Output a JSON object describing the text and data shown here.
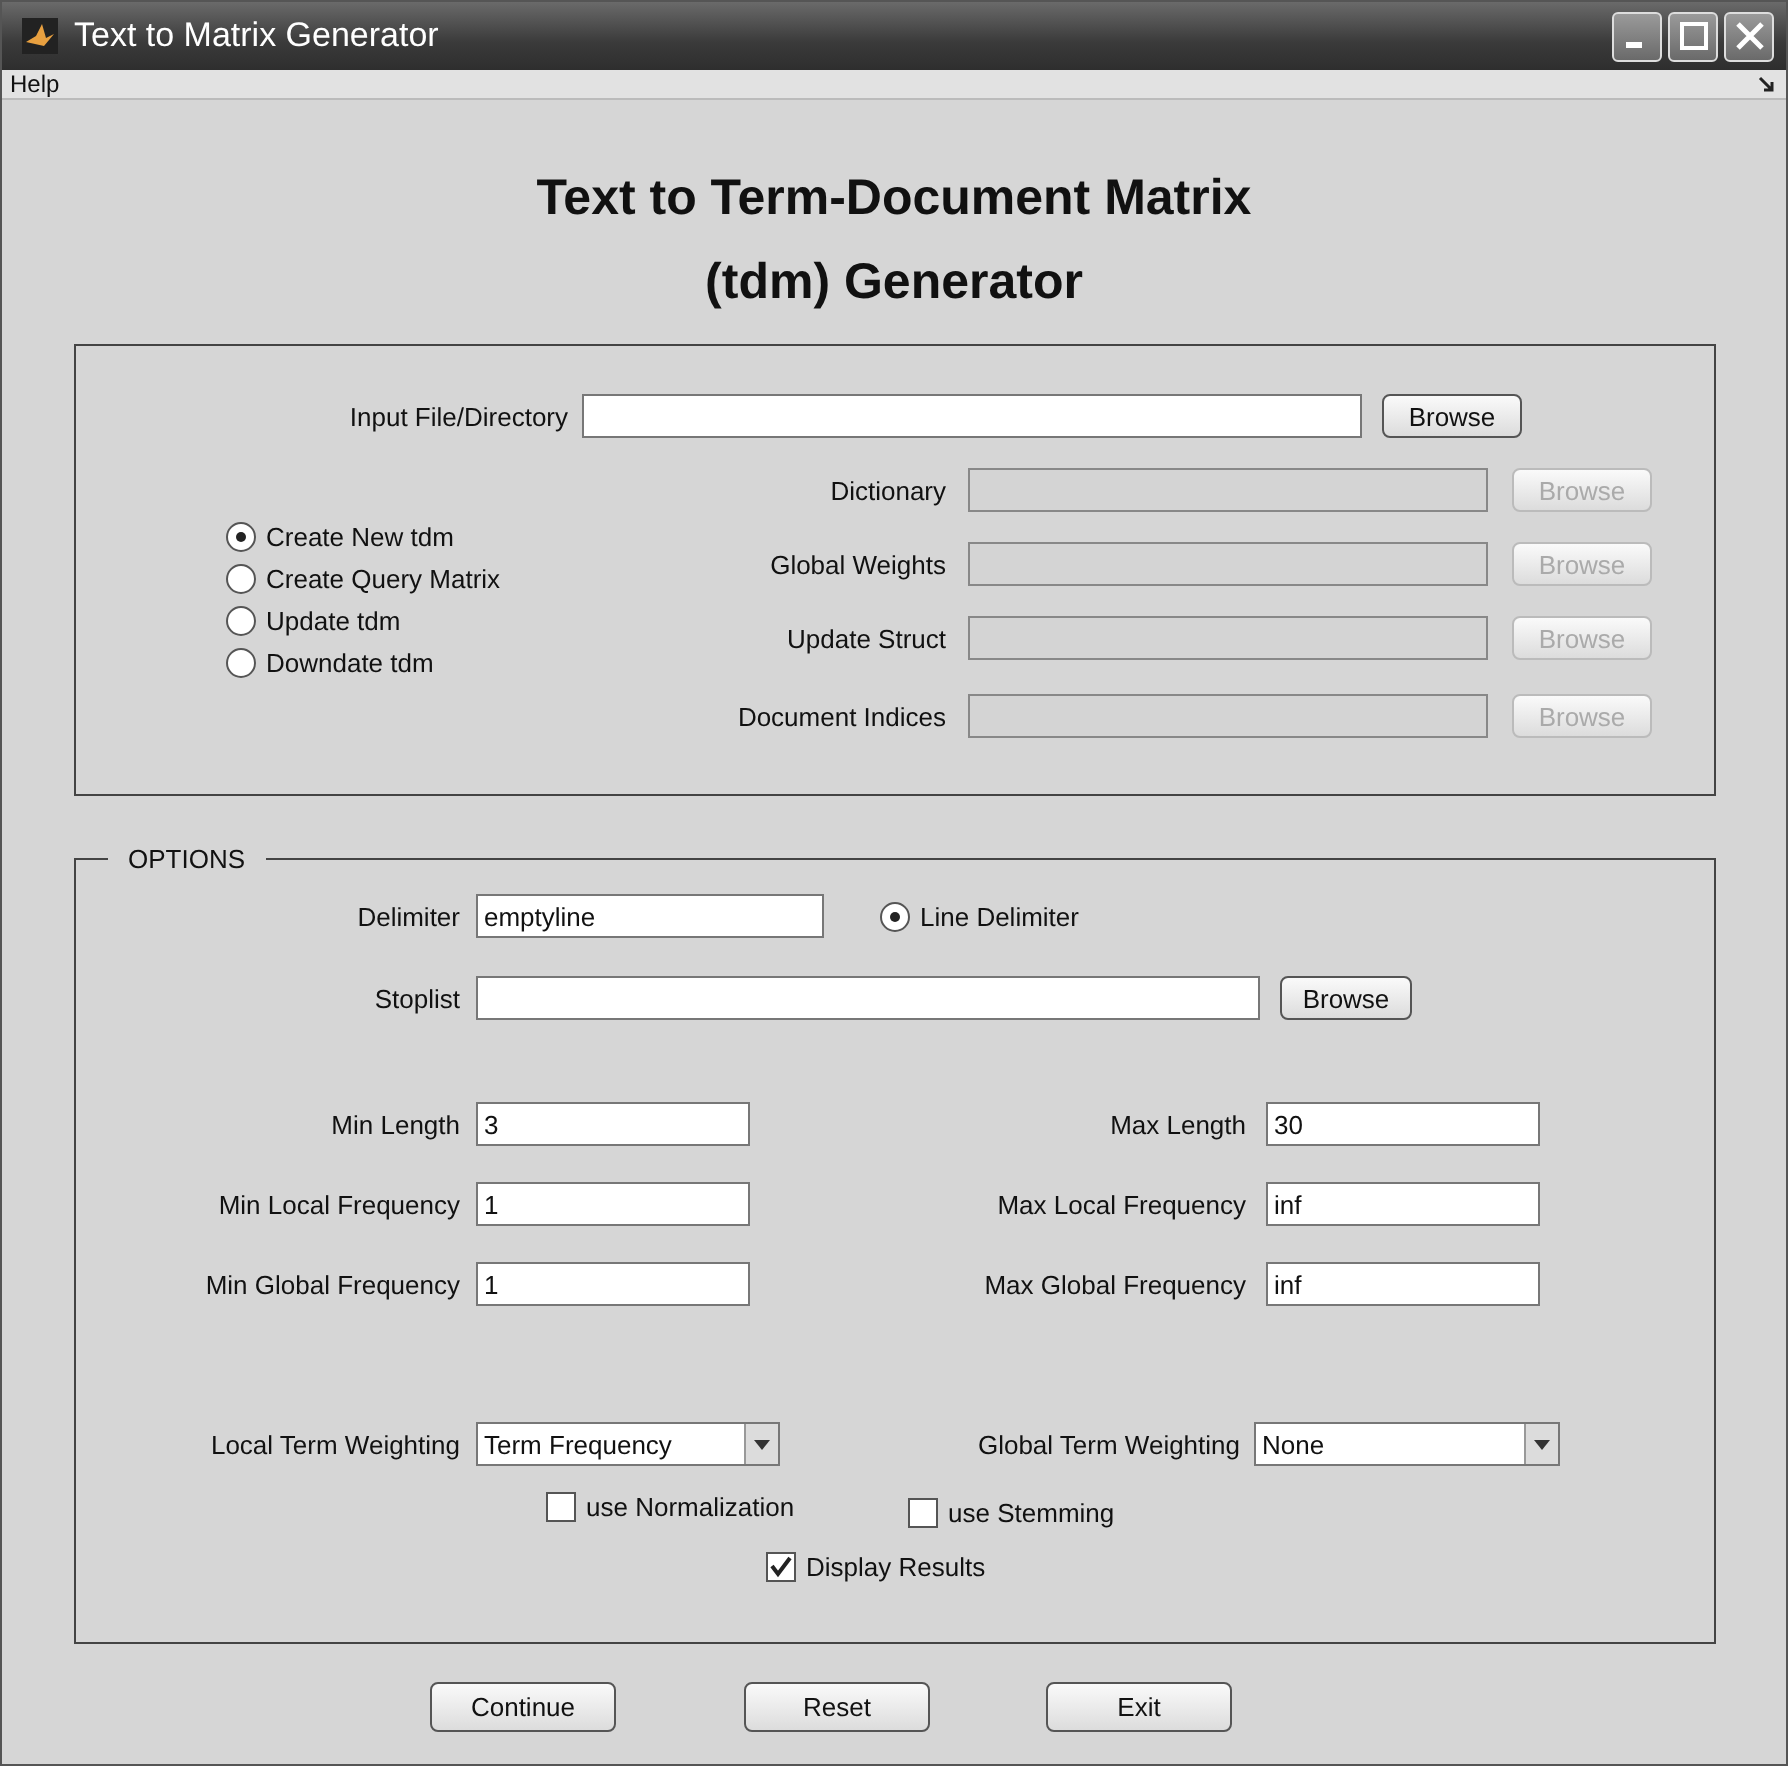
{
  "window": {
    "title": "Text to Matrix Generator"
  },
  "menu": [
    "Help"
  ],
  "heading": [
    "Text to Term-Document Matrix",
    "(tdm) Generator"
  ],
  "input": {
    "label": "Input File/Directory",
    "button": "Browse"
  },
  "modes": [
    {
      "label": "Create New tdm",
      "selected": true
    },
    {
      "label": "Create Query Matrix",
      "selected": false
    },
    {
      "label": "Update tdm",
      "selected": false
    },
    {
      "label": "Downdate tdm",
      "selected": false
    }
  ],
  "files": [
    {
      "label": "Dictionary",
      "button": "Browse",
      "disabled": true
    },
    {
      "label": "Global Weights",
      "button": "Browse",
      "disabled": true
    },
    {
      "label": "Update Struct",
      "button": "Browse",
      "disabled": true
    },
    {
      "label": "Document Indices",
      "button": "Browse",
      "disabled": true
    }
  ],
  "options": {
    "title": "OPTIONS",
    "delimiter": {
      "label": "Delimiter",
      "value": "emptyline"
    },
    "line_delimiter": {
      "label": "Line Delimiter",
      "selected": true
    },
    "stoplist": {
      "label": "Stoplist",
      "button": "Browse"
    },
    "limits": [
      {
        "min_label": "Min Length",
        "min_value": "3",
        "max_label": "Max Length",
        "max_value": "30"
      },
      {
        "min_label": "Min Local Frequency",
        "min_value": "1",
        "max_label": "Max Local Frequency",
        "max_value": "inf"
      },
      {
        "min_label": "Min Global Frequency",
        "min_value": "1",
        "max_label": "Max Global Frequency",
        "max_value": "inf"
      }
    ],
    "weighting": [
      {
        "label": "Local Term Weighting",
        "value": "Term Frequency"
      },
      {
        "label": "Global Term Weighting",
        "value": "None"
      }
    ],
    "checkboxes": [
      {
        "label": "use Normalization",
        "checked": false
      },
      {
        "label": "use Stemming",
        "checked": false
      },
      {
        "label": "Display Results",
        "checked": true
      }
    ]
  },
  "buttons": [
    "Continue",
    "Reset",
    "Exit"
  ]
}
